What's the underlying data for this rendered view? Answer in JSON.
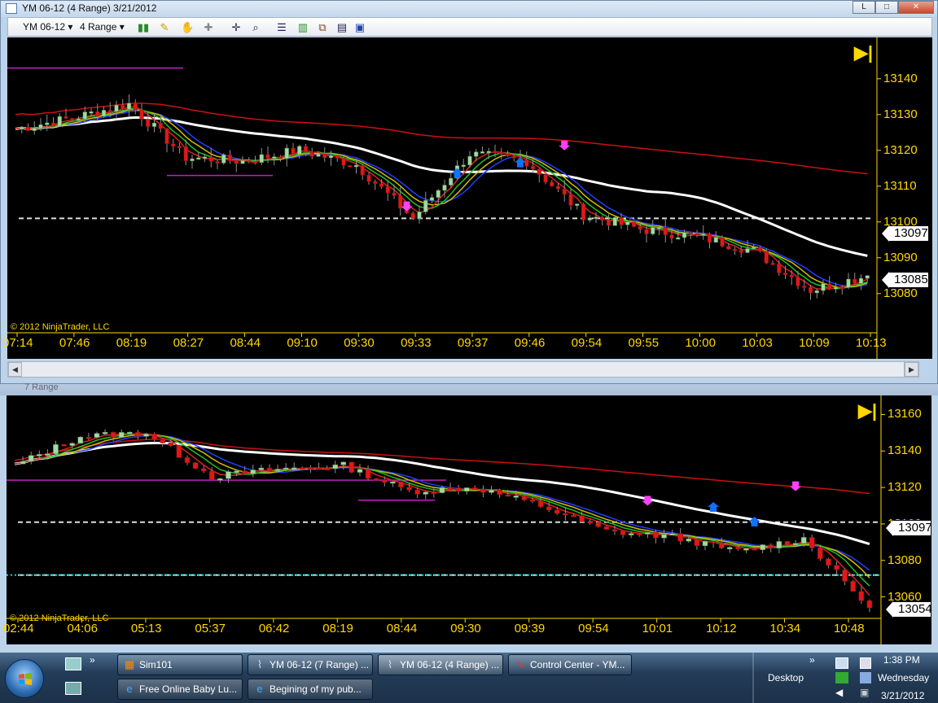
{
  "window1": {
    "title": "YM 06-12 (4 Range)  3/21/2012",
    "controls": {
      "minimize": "L",
      "maximize": "□",
      "close": "✕"
    },
    "toolbar": {
      "instrument": "YM 06-12",
      "period": "4 Range",
      "icons": [
        "candlestick-icon",
        "pencil-icon",
        "crosshair-icon",
        "zoom-icon",
        "properties-icon",
        "data-box-icon",
        "strategy-icon"
      ]
    },
    "chart": {
      "copyright": "© 2012 NinjaTrader, LLC",
      "y_ticks": [
        "13140",
        "13130",
        "13120",
        "13110",
        "13100",
        "13090",
        "13080"
      ],
      "x_ticks": [
        "07:14",
        "07:46",
        "08:19",
        "08:27",
        "08:44",
        "09:10",
        "09:30",
        "09:33",
        "09:37",
        "09:46",
        "09:54",
        "09:55",
        "10:00",
        "10:03",
        "10:09",
        "10:13"
      ],
      "price_box_1": "13097",
      "price_box_2": "13085",
      "end_marker": "▶|"
    }
  },
  "window2": {
    "title": "YM 06-12 (7 Range)",
    "period": "7 Range",
    "chart": {
      "copyright": "© 2012 NinjaTrader, LLC",
      "y_ticks": [
        "13160",
        "13140",
        "13120",
        "13100",
        "13080",
        "13060"
      ],
      "x_ticks": [
        "02:44",
        "04:06",
        "05:13",
        "05:37",
        "06:42",
        "08:19",
        "08:44",
        "09:30",
        "09:39",
        "09:54",
        "10:01",
        "10:12",
        "10:34",
        "10:48"
      ],
      "price_box_1": "13097",
      "price_box_2": "13054",
      "end_marker": "▶|"
    }
  },
  "chart_data": [
    {
      "type": "candlestick",
      "title": "YM 06-12 (4 Range)",
      "ylim": [
        13072,
        13147
      ],
      "x": [
        "07:14",
        "07:46",
        "08:19",
        "08:27",
        "08:44",
        "09:10",
        "09:30",
        "09:33",
        "09:37",
        "09:46",
        "09:54",
        "09:55",
        "10:00",
        "10:03",
        "10:09",
        "10:13"
      ],
      "close": [
        13126,
        13129,
        13133,
        13118,
        13117,
        13120,
        13116,
        13101,
        13119,
        13117,
        13102,
        13098,
        13096,
        13092,
        13081,
        13085
      ],
      "horizontal_lines": [
        13101
      ],
      "current_prices": [
        13097,
        13085
      ]
    },
    {
      "type": "candlestick",
      "title": "YM 06-12 (7 Range)",
      "ylim": [
        13050,
        13166
      ],
      "x": [
        "02:44",
        "04:06",
        "05:13",
        "05:37",
        "06:42",
        "08:19",
        "08:44",
        "09:30",
        "09:39",
        "09:54",
        "10:01",
        "10:12",
        "10:34",
        "10:48"
      ],
      "close": [
        13132,
        13148,
        13150,
        13126,
        13130,
        13132,
        13118,
        13120,
        13110,
        13096,
        13093,
        13085,
        13092,
        13054
      ],
      "horizontal_lines": [
        13101,
        13072
      ],
      "current_prices": [
        13097,
        13054
      ]
    }
  ],
  "taskbar": {
    "tasks": [
      {
        "label": "Sim101"
      },
      {
        "label": "YM 06-12 (7 Range) ..."
      },
      {
        "label": "YM 06-12 (4 Range) ..."
      },
      {
        "label": "Control Center - YM..."
      },
      {
        "label": "Free Online Baby Lu..."
      },
      {
        "label": "Begining of my pub..."
      }
    ],
    "desktop_label": "Desktop",
    "time": "1:38 PM",
    "day": "Wednesday",
    "date": "3/21/2012"
  }
}
